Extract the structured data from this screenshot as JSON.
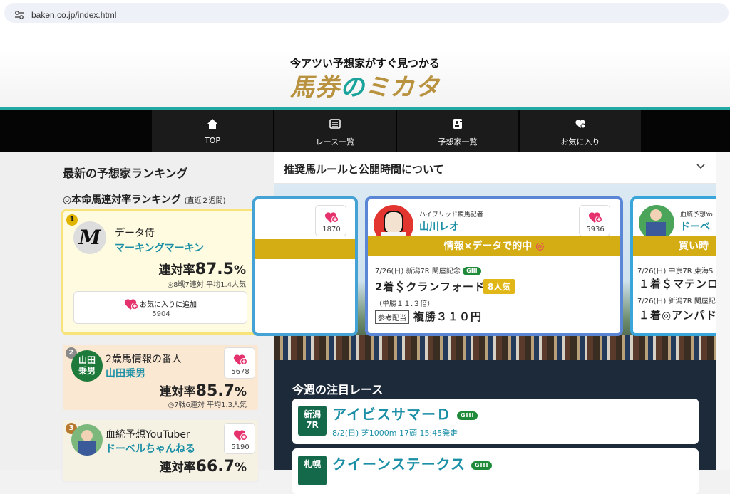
{
  "browser": {
    "url": "baken.co.jp/index.html"
  },
  "header": {
    "tagline": "今アツい予想家がすぐ見つかる",
    "logo_text": [
      "馬券",
      "の",
      "ミカタ"
    ]
  },
  "nav": [
    {
      "label": "TOP",
      "icon": "home-icon"
    },
    {
      "label": "レース一覧",
      "icon": "list-icon"
    },
    {
      "label": "予想家一覧",
      "icon": "profile-icon"
    },
    {
      "label": "お気に入り",
      "icon": "heart-icon"
    }
  ],
  "sidebar": {
    "title": "最新の予想家ランキング",
    "subtitle": "◎本命馬連対率ランキング",
    "subtitle_note": "(直近２週間)",
    "ranks": [
      {
        "num": "1",
        "category": "データ侍",
        "name": "マーキングマーキン",
        "rate_label": "連対率",
        "rate": "87.5",
        "unit": "%",
        "stat": "◎8戦7連対 平均1.4人気",
        "fav_label": "お気に入りに追加",
        "fav": "5904"
      },
      {
        "num": "2",
        "category": "2歳馬情報の番人",
        "name": "山田乗男",
        "avatar_text": "山田乗男",
        "rate_label": "連対率",
        "rate": "85.7",
        "unit": "%",
        "stat": "◎7戦6連対 平均1.3人気",
        "fav": "5678"
      },
      {
        "num": "3",
        "category": "血統予想YouTuber",
        "name": "ドーベルちゃんねる",
        "rate_label": "連対率",
        "rate": "66.7",
        "unit": "%",
        "fav": "5190"
      }
    ]
  },
  "main": {
    "accordion_title": "推奨馬ルールと公開時間について",
    "cards": [
      {
        "fav": "1870"
      },
      {
        "role": "ハイブリッド競馬記者",
        "name": "山川レオ",
        "fav": "5936",
        "tagline": "情報×データで的中",
        "race": "7/26(日) 新潟7R 関屋記念",
        "grade": "GIII",
        "result": "2着＄クランフォード",
        "pop": "8人気",
        "odds": "（単勝１１.３倍）",
        "ref": "参考配当",
        "payout": "複勝３１０円"
      },
      {
        "role": "血統予想Yo",
        "name": "ドーベ",
        "tagline": "買い時",
        "race1": "7/26(日) 中京7R 東海S",
        "result1": "１着＄マテンロ",
        "race2": "7/26(日) 新潟7R 関屋記",
        "result2": "１着◎アンパド"
      }
    ],
    "week_title": "今週の注目レース",
    "races": [
      {
        "venue": "新潟",
        "r": "7R",
        "name": "アイビスサマーＤ",
        "grade": "GIII",
        "info": "8/2(日) 芝1000m 17頭 15:45発走"
      },
      {
        "venue": "札幌",
        "r": "",
        "name": "クイーンステークス",
        "grade": "GIII"
      }
    ]
  },
  "colors": {
    "teal": "#22a9a3",
    "gold": "#d4ac14",
    "link": "#1b8fa6",
    "pink": "#e5326d"
  }
}
